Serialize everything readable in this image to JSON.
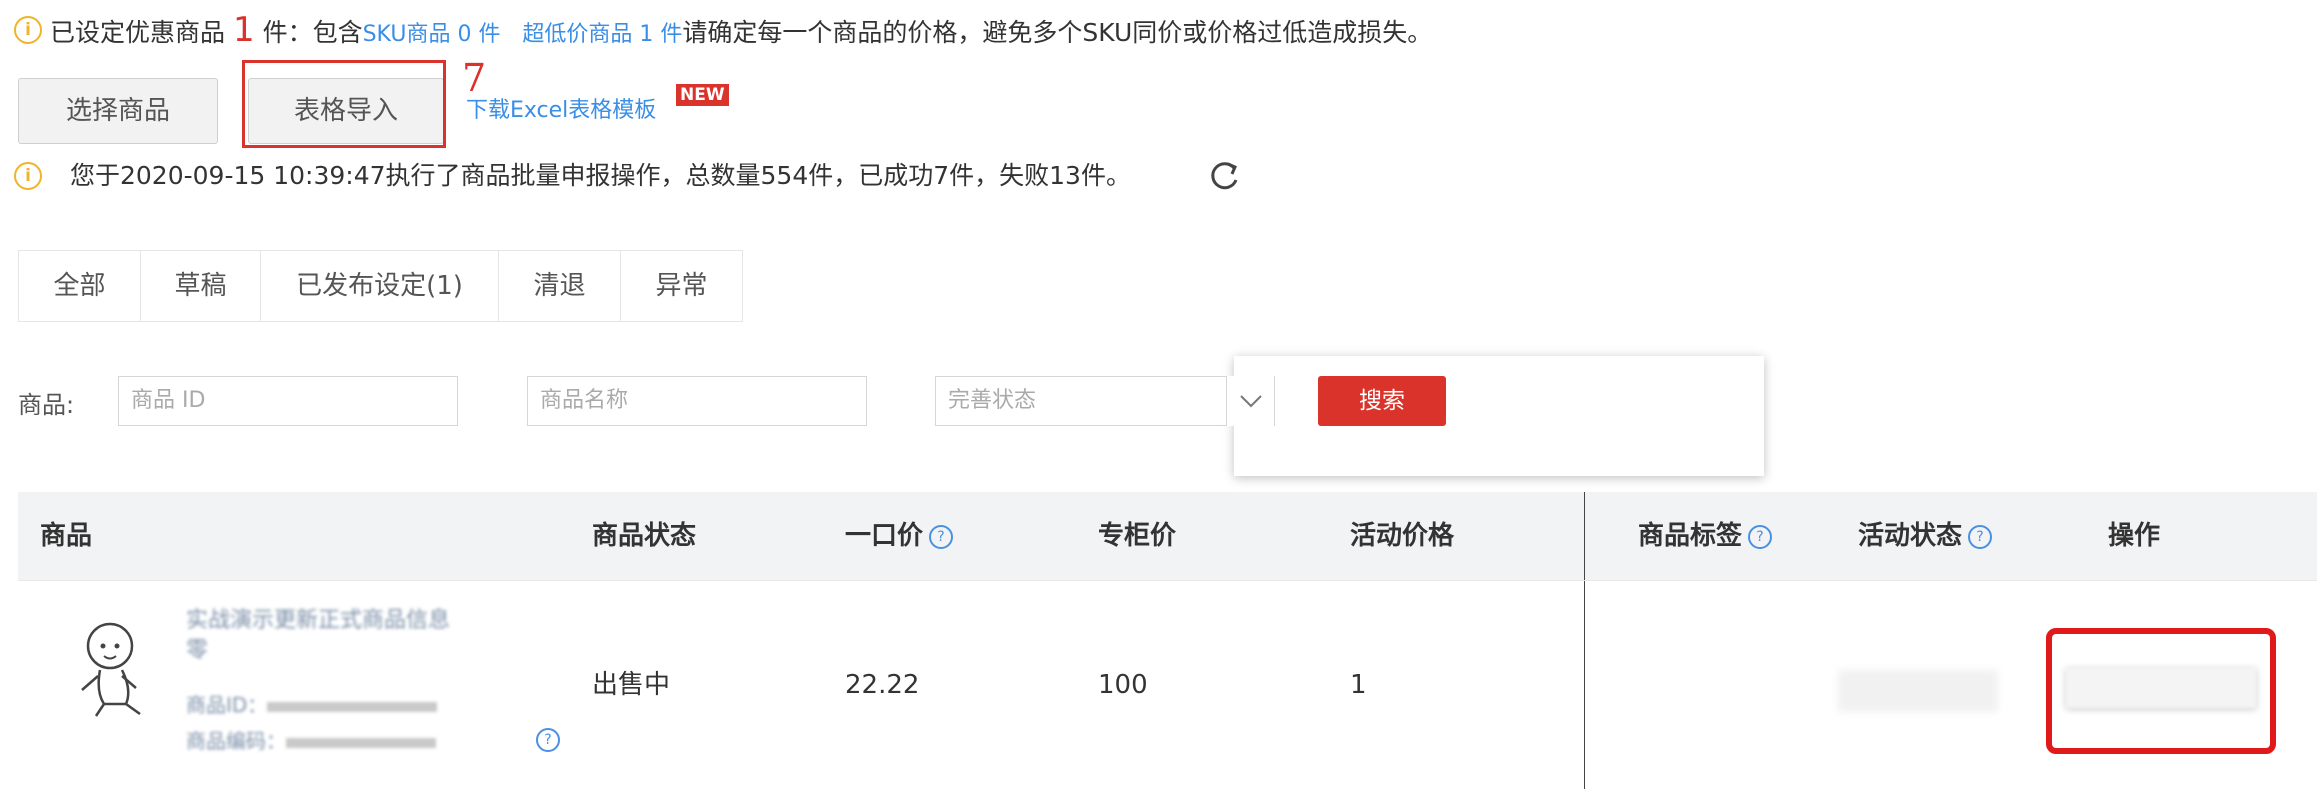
{
  "notice1": {
    "prefix": "已设定优惠商品",
    "count": "1",
    "mid": "件：包含",
    "sku_link": "SKU商品 0 件",
    "low_link": "超低价商品 1 件",
    "suffix": "请确定每一个商品的价格，避免多个SKU同价或价格过低造成损失。"
  },
  "actions": {
    "select_label": "选择商品",
    "import_label": "表格导入",
    "annotation_number": "7",
    "download_link": "下载Excel表格模板",
    "new_badge": "NEW"
  },
  "notice2": {
    "text": "您于2020-09-15 10:39:47执行了商品批量申报操作，总数量554件，已成功7件，失败13件。"
  },
  "tabs": [
    "全部",
    "草稿",
    "已发布设定(1)",
    "清退",
    "异常"
  ],
  "filters": {
    "label": "商品:",
    "id_placeholder": "商品 ID",
    "name_placeholder": "商品名称",
    "status_placeholder": "完善状态",
    "search_label": "搜索"
  },
  "table": {
    "headers": [
      "商品",
      "商品状态",
      "一口价",
      "专柜价",
      "活动价格",
      "商品标签",
      "活动状态",
      "操作"
    ],
    "row": {
      "title": "实战演示更新正式商品信息",
      "title_line2": "零",
      "meta1": "商品ID：",
      "meta2": "商品编码：",
      "status": "出售中",
      "price": "22.22",
      "counter_price": "100",
      "activity_price": "1"
    }
  },
  "colors": {
    "accent_red": "#d9332b",
    "link_blue": "#3a8ee6",
    "warning": "#f0b429"
  }
}
